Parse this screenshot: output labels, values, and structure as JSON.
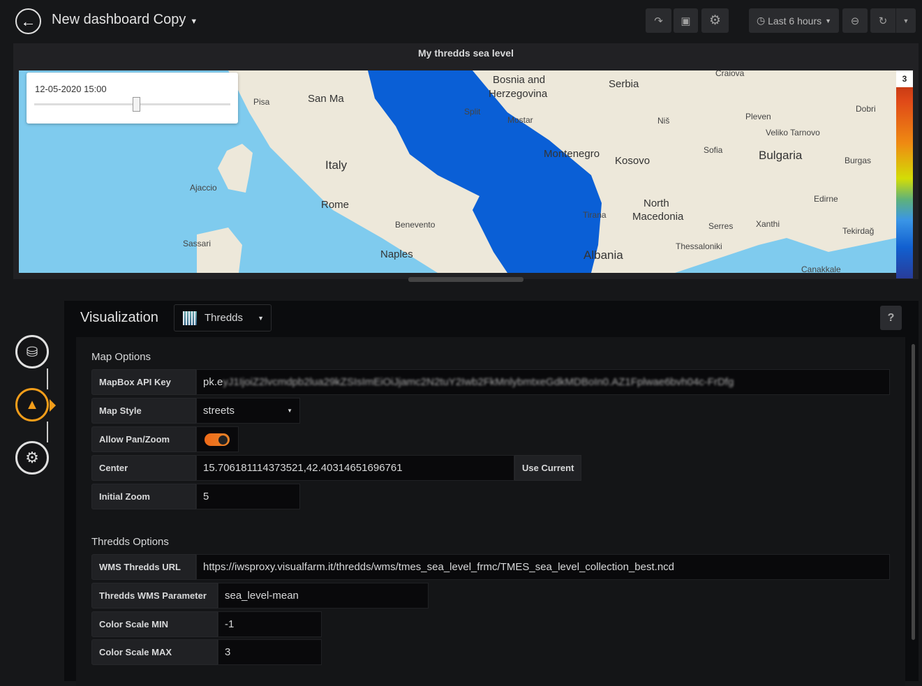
{
  "header": {
    "title": "New dashboard Copy",
    "time_range": "Last 6 hours",
    "icons": [
      "share-icon",
      "save-icon",
      "gear-icon",
      "clock-icon",
      "zoom-out-icon",
      "refresh-icon",
      "caret-down-icon"
    ]
  },
  "panel": {
    "title": "My thredds sea level",
    "time_label": "12-05-2020 15:00",
    "time_position": 0.52,
    "color_scale_max_label": "3",
    "map_labels": [
      "Bosnia and",
      "Herzegovina",
      "Serbia",
      "Craiova",
      "San Ma",
      "Pisa",
      "Split",
      "Mostar",
      "Niš",
      "Pleven",
      "Dobri",
      "Veliko Tarnovo",
      "Montenegro",
      "Kosovo",
      "Sofia",
      "Bulgaria",
      "Burgas",
      "Italy",
      "Ajaccio",
      "Rome",
      "Edirne",
      "North",
      "Macedonia",
      "Tirana",
      "Serres",
      "Xanthi",
      "Tekirdağ",
      "Benevento",
      "Sassari",
      "Naples",
      "Thessaloniki",
      "Albania",
      "Canakkale"
    ]
  },
  "sidebar": {
    "steps": [
      "database-icon",
      "chart-area-icon",
      "wrench-gear-icon"
    ],
    "active": 1
  },
  "editor": {
    "title": "Visualization",
    "plugin": "Thredds",
    "help": "?",
    "map_options": {
      "heading": "Map Options",
      "api_key_label": "MapBox API Key",
      "api_key_prefix": "pk.e",
      "api_key_masked": "yJ1IjoiZ2lvcmdpb2lua29kZSIsImEiOiJjamc2N2tuY2Iwb2FkMnlybmtxeGdkMDBoIn0.AZ1Fplwae6bvh04c-FrDfg",
      "style_label": "Map Style",
      "style_value": "streets",
      "pan_label": "Allow Pan/Zoom",
      "pan_enabled": true,
      "center_label": "Center",
      "center_value": "15.706181114373521,42.40314651696761",
      "use_current": "Use Current",
      "zoom_label": "Initial Zoom",
      "zoom_value": "5"
    },
    "thredds_options": {
      "heading": "Thredds Options",
      "url_label": "WMS Thredds URL",
      "url_value": "https://iwsproxy.visualfarm.it/thredds/wms/tmes_sea_level_frmc/TMES_sea_level_collection_best.ncd",
      "param_label": "Thredds WMS Parameter",
      "param_value": "sea_level-mean",
      "min_label": "Color Scale MIN",
      "min_value": "-1",
      "max_label": "Color Scale MAX",
      "max_value": "3"
    }
  },
  "colors": {
    "accent": "#f06a18",
    "background": "#161719",
    "sea_light": "#7fcbee",
    "sea_data": "#0a5fd6"
  }
}
